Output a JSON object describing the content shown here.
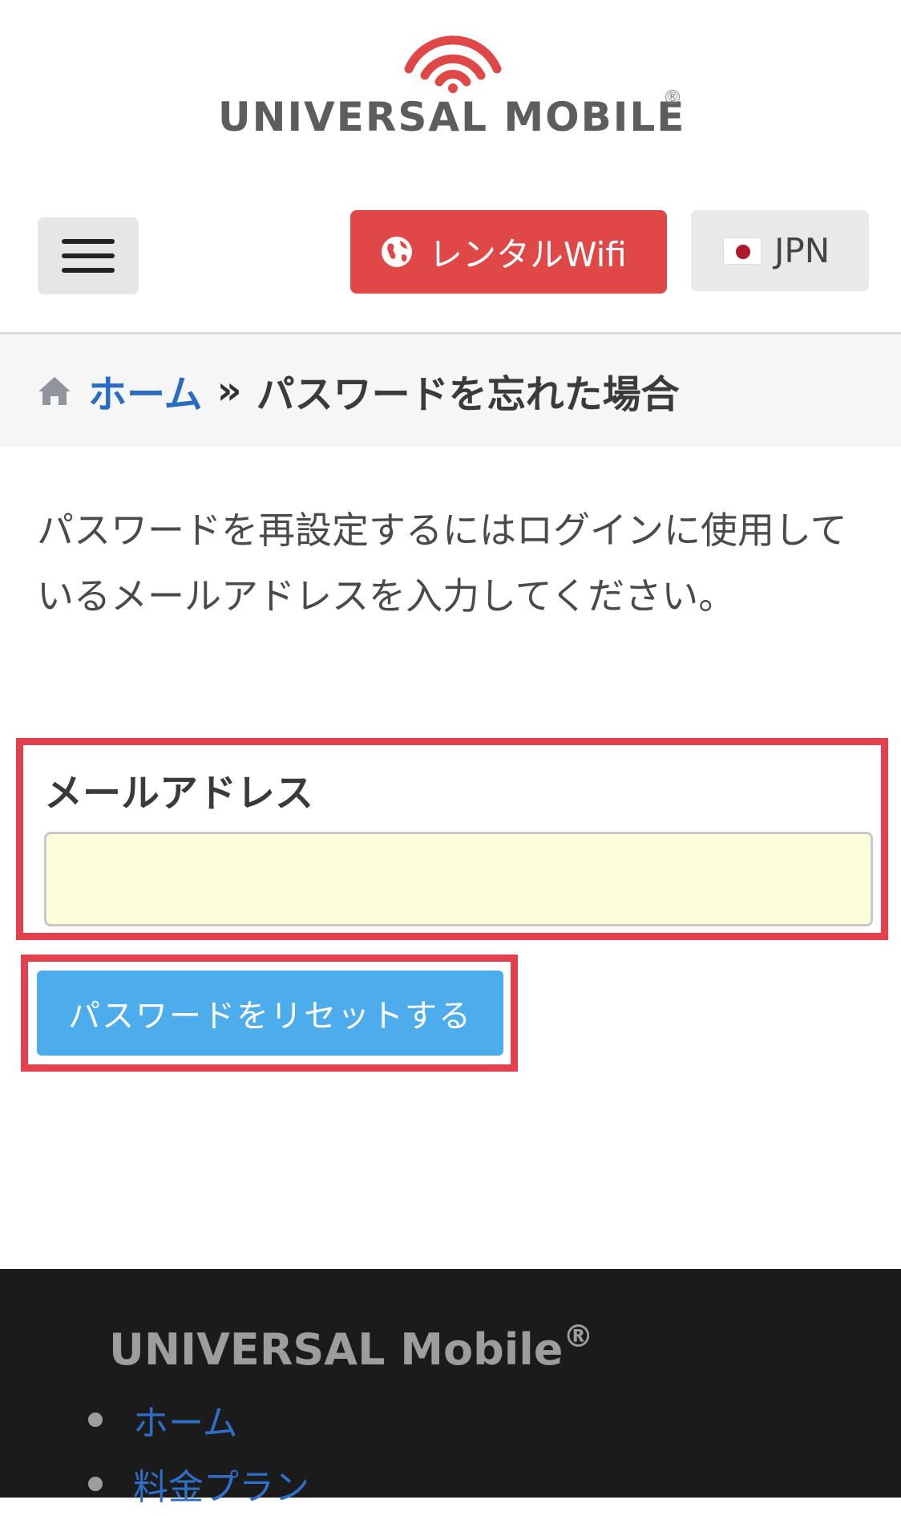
{
  "header": {
    "logo_text": "UNIVERSAL MOBILE",
    "logo_registered": "®"
  },
  "nav": {
    "rental_wifi_label": "レンタルWifi",
    "language_label": "JPN"
  },
  "breadcrumb": {
    "home": "ホーム",
    "separator": "»",
    "current": "パスワードを忘れた場合"
  },
  "instructions": "パスワードを再設定するにはログインに使用しているメールアドレスを入力してください。",
  "form": {
    "email_label": "メールアドレス",
    "email_value": "",
    "submit_label": "パスワードをリセットする"
  },
  "footer": {
    "title": "UNIVERSAL Mobile",
    "title_mark": "®",
    "links": [
      "ホーム",
      "料金プラン"
    ]
  },
  "colors": {
    "brand_red": "#e04747",
    "highlight_red": "#e5404d",
    "button_blue": "#4dadec",
    "link_blue": "#2a6bc4",
    "footer_bg": "#1b1b1b"
  }
}
